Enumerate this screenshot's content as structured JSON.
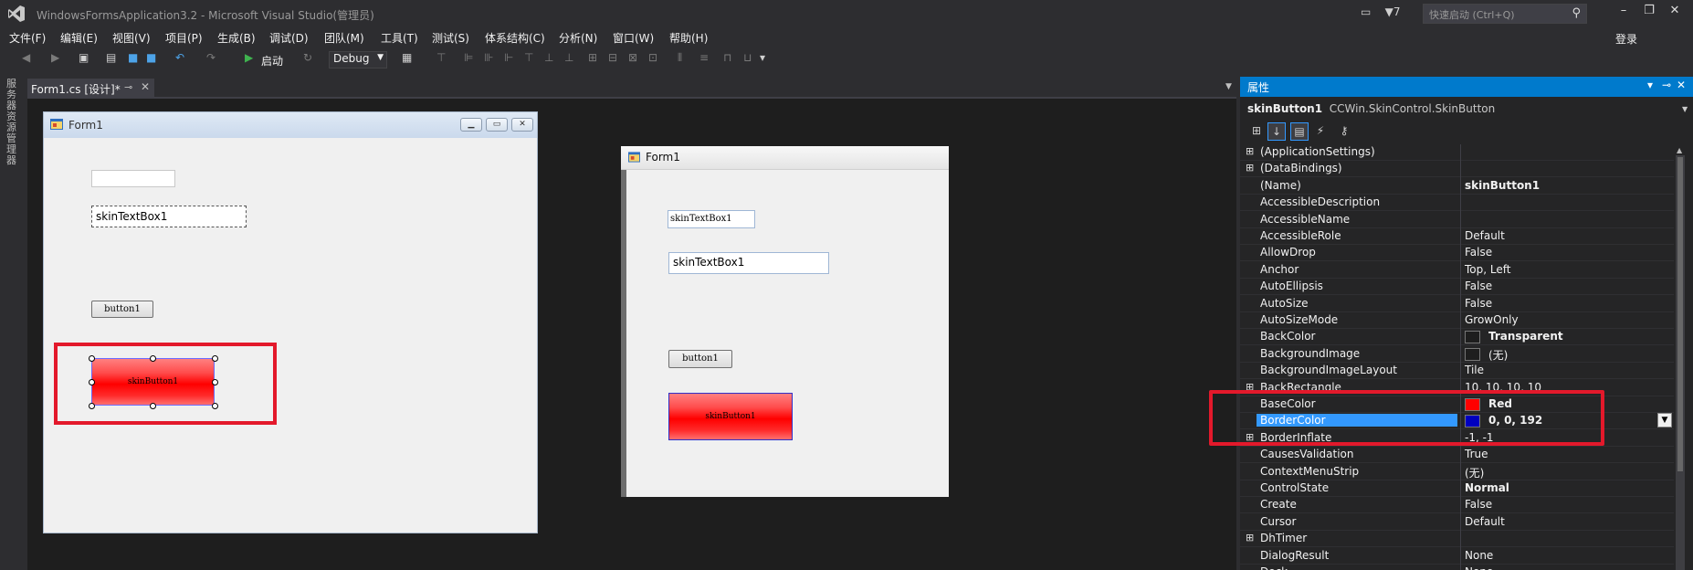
{
  "window": {
    "title": "WindowsFormsApplication3.2 - Microsoft Visual Studio(管理员)",
    "notification_count": "7",
    "quick_launch_placeholder": "快速启动 (Ctrl+Q)",
    "login": "登录"
  },
  "menu": [
    "文件(F)",
    "编辑(E)",
    "视图(V)",
    "项目(P)",
    "生成(B)",
    "调试(D)",
    "团队(M)",
    "工具(T)",
    "测试(S)",
    "体系结构(C)",
    "分析(N)",
    "窗口(W)",
    "帮助(H)"
  ],
  "toolbar": {
    "start_label": "启动",
    "config": "Debug"
  },
  "left_strip": "服务器资源管理器",
  "doc_tab": {
    "label": "Form1.cs [设计]*"
  },
  "design_form": {
    "title": "Form1",
    "skin_textbox": "skinTextBox1",
    "button1": "button1",
    "skin_button": "skinButton1"
  },
  "runtime_form": {
    "title": "Form1",
    "skin_textbox_small": "skinTextBox1",
    "skin_textbox": "skinTextBox1",
    "button1": "button1",
    "skin_button": "skinButton1"
  },
  "properties": {
    "header": "属性",
    "object_name": "skinButton1",
    "object_type": "CCWin.SkinControl.SkinButton",
    "rows": [
      {
        "name": "(ApplicationSettings)",
        "value": "",
        "expand": "⊞"
      },
      {
        "name": "(DataBindings)",
        "value": "",
        "expand": "⊞"
      },
      {
        "name": "(Name)",
        "value": "skinButton1",
        "bold": true
      },
      {
        "name": "AccessibleDescription",
        "value": ""
      },
      {
        "name": "AccessibleName",
        "value": ""
      },
      {
        "name": "AccessibleRole",
        "value": "Default"
      },
      {
        "name": "AllowDrop",
        "value": "False"
      },
      {
        "name": "Anchor",
        "value": "Top, Left"
      },
      {
        "name": "AutoEllipsis",
        "value": "False"
      },
      {
        "name": "AutoSize",
        "value": "False"
      },
      {
        "name": "AutoSizeMode",
        "value": "GrowOnly"
      },
      {
        "name": "BackColor",
        "value": "Transparent",
        "swatch": "#1e1e1e",
        "bold": true
      },
      {
        "name": "BackgroundImage",
        "value": "(无)",
        "swatch": "#1e1e1e"
      },
      {
        "name": "BackgroundImageLayout",
        "value": "Tile"
      },
      {
        "name": "BackRectangle",
        "value": "10, 10, 10, 10",
        "expand": "⊞"
      },
      {
        "name": "BaseColor",
        "value": "Red",
        "swatch": "#ff0000",
        "bold": true
      },
      {
        "name": "BorderColor",
        "value": "0, 0, 192",
        "swatch": "#0000c0",
        "bold": true,
        "selected": true
      },
      {
        "name": "BorderInflate",
        "value": "-1, -1",
        "expand": "⊞"
      },
      {
        "name": "CausesValidation",
        "value": "True"
      },
      {
        "name": "ContextMenuStrip",
        "value": "(无)"
      },
      {
        "name": "ControlState",
        "value": "Normal",
        "bold": true
      },
      {
        "name": "Create",
        "value": "False"
      },
      {
        "name": "Cursor",
        "value": "Default"
      },
      {
        "name": "DhTimer",
        "value": "",
        "expand": "⊞"
      },
      {
        "name": "DialogResult",
        "value": "None"
      },
      {
        "name": "Dock",
        "value": "None"
      }
    ]
  },
  "colors": {
    "accent": "#007acc",
    "highlight_red": "#e3192b",
    "selected_row": "#3399ff"
  }
}
